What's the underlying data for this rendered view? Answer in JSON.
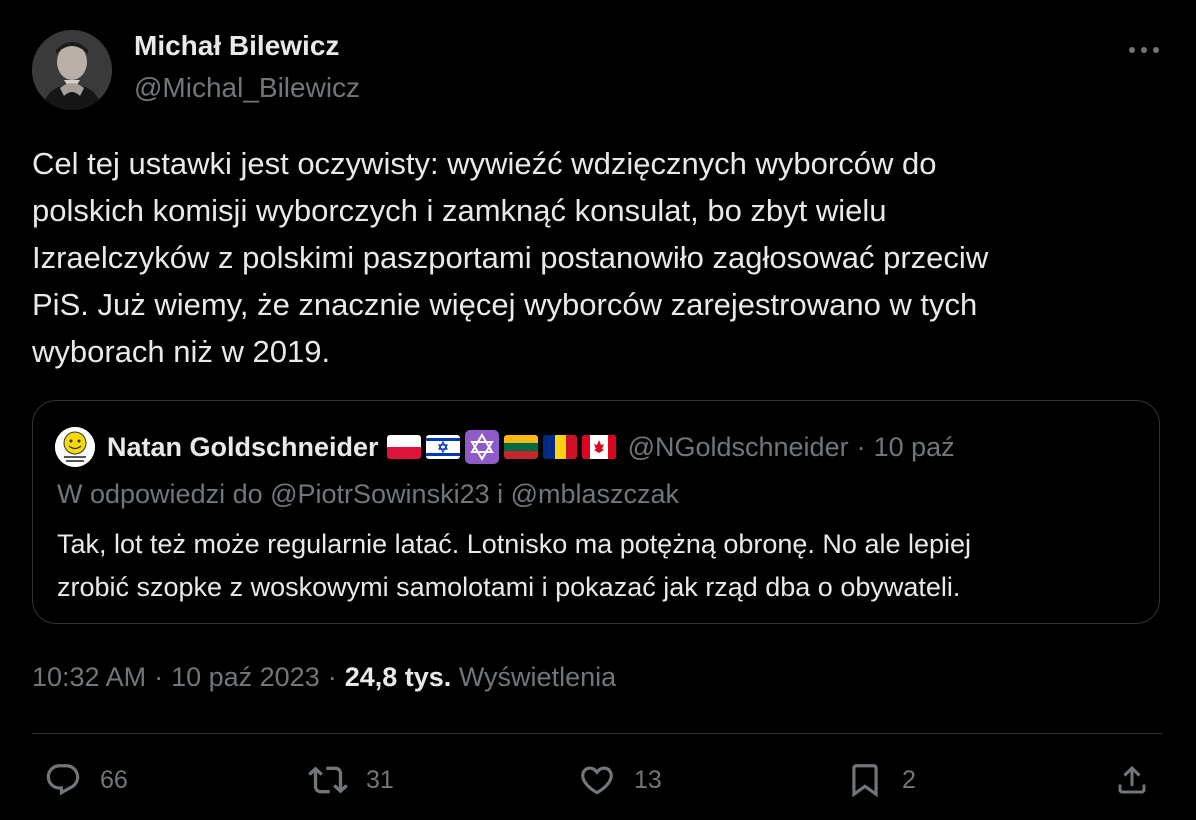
{
  "author": {
    "name": "Michał Bilewicz",
    "handle": "@Michal_Bilewicz"
  },
  "tweet": {
    "lines": [
      "Cel tej ustawki jest oczywisty: wywieźć wdzięcznych wyborców do",
      "polskich komisji wyborczych i zamknąć konsulat, bo zbyt wielu",
      "Izraelczyków z polskimi paszportami postanowiło zagłosować przeciw",
      "PiS. Już wiemy, że znacznie więcej wyborców zarejestrowano w tych",
      "wyborach niż w 2019."
    ]
  },
  "quote": {
    "name": "Natan Goldschneider",
    "flags": [
      "poland-flag-icon",
      "israel-flag-icon",
      "star-of-david-icon",
      "lithuania-flag-icon",
      "romania-flag-icon",
      "canada-flag-icon"
    ],
    "handle": "@NGoldschneider",
    "dot": "·",
    "date": "10 paź",
    "reply_to": "W odpowiedzi do @PiotrSowinski23 i @mblaszczak",
    "lines": [
      "Tak, lot też może regularnie latać. Lotnisko ma potężną obronę. No ale lepiej",
      "zrobić szopke z woskowymi samolotami i pokazać jak rząd dba o obywateli."
    ]
  },
  "meta": {
    "time": "10:32 AM",
    "dot": "·",
    "date": "10 paź 2023",
    "views_count": "24,8 tys.",
    "views_label": "Wyświetlenia"
  },
  "actions": {
    "replies": "66",
    "reposts": "31",
    "likes": "13",
    "bookmarks": "2"
  },
  "colors": {
    "background": "#000000",
    "text": "#e7e9ea",
    "muted": "#71767b",
    "border": "#2f3336"
  }
}
